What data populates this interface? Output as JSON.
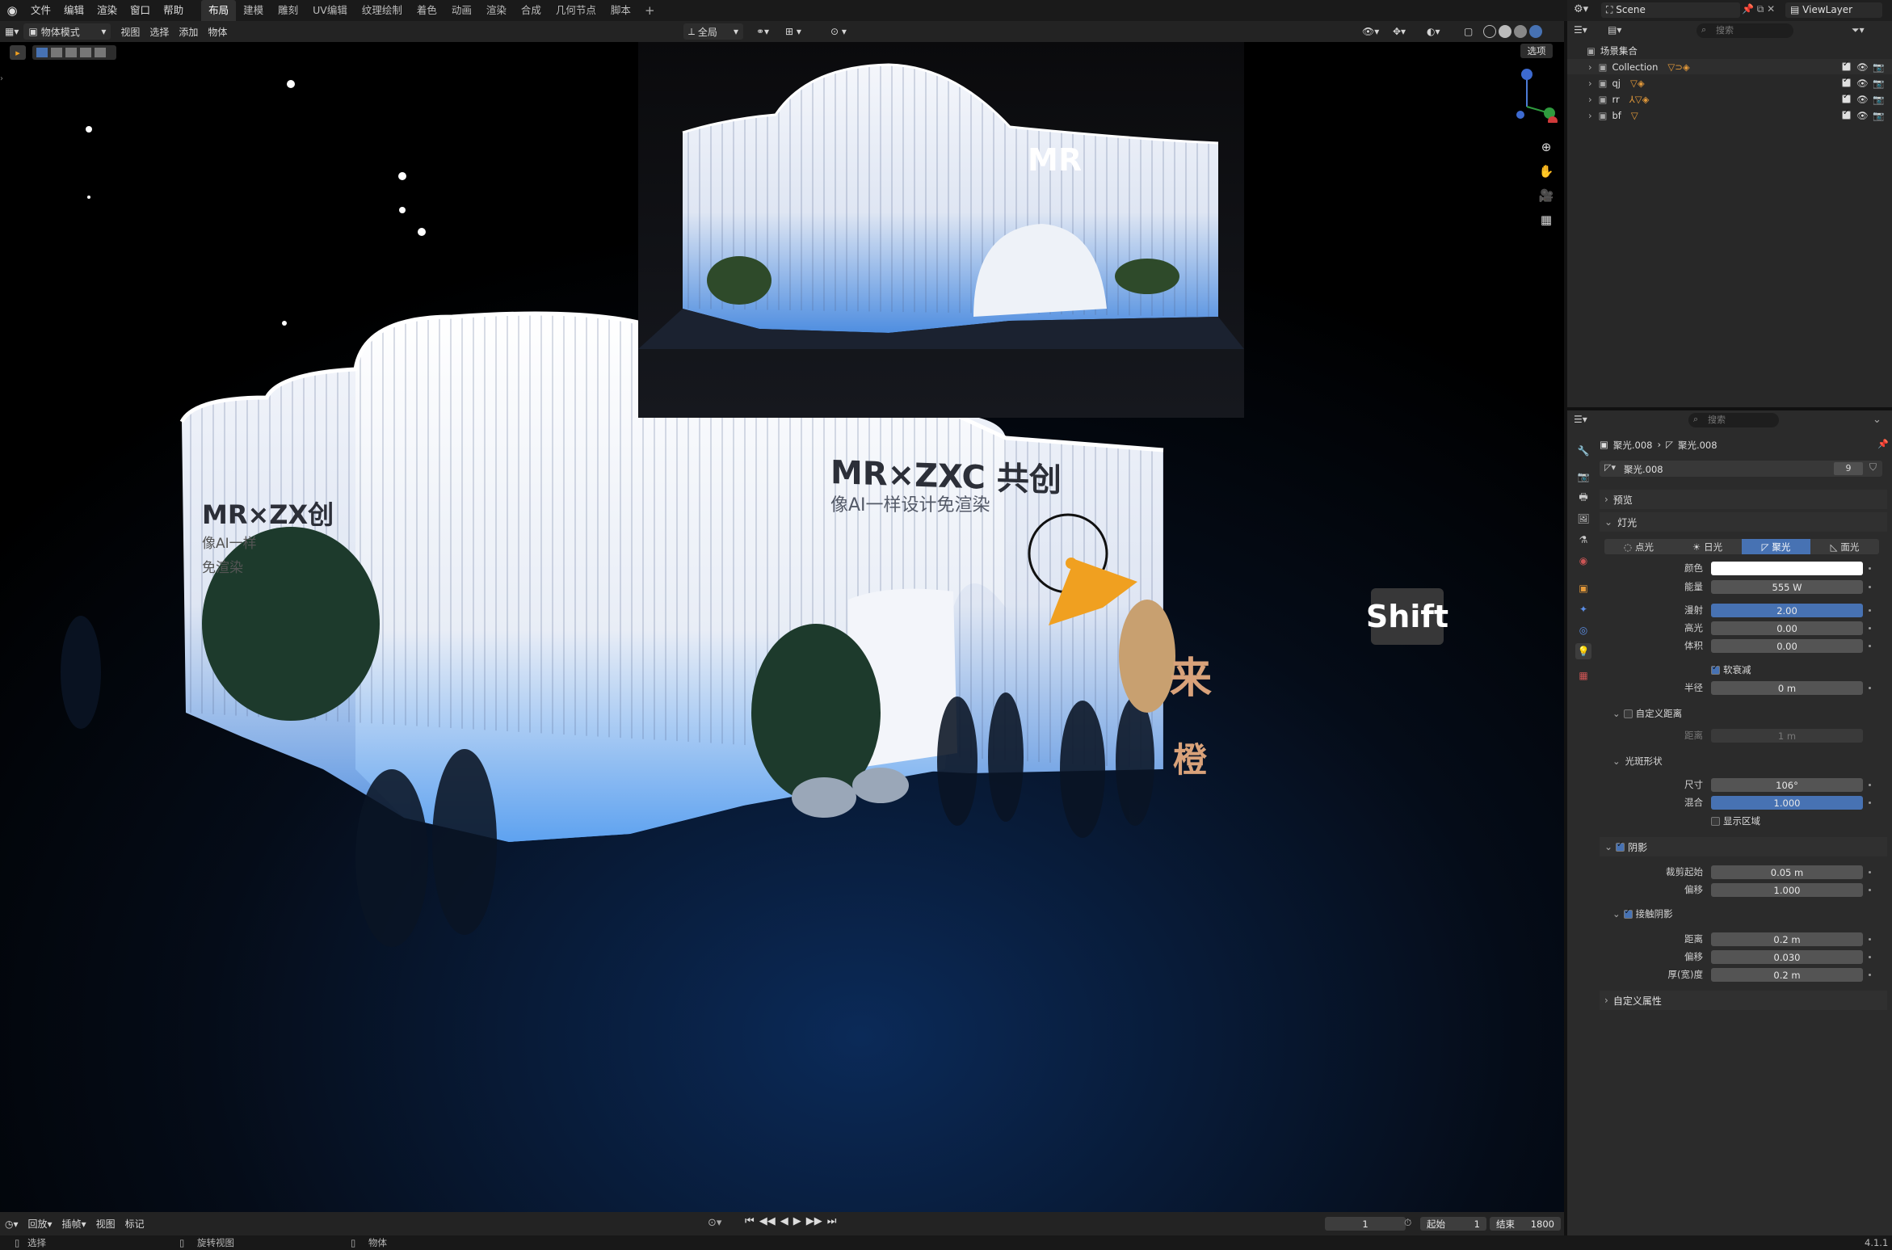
{
  "topbar": {
    "menus": [
      "文件",
      "编辑",
      "渲染",
      "窗口",
      "帮助"
    ],
    "workspaces": [
      "布局",
      "建模",
      "雕刻",
      "UV编辑",
      "纹理绘制",
      "着色",
      "动画",
      "渲染",
      "合成",
      "几何节点",
      "脚本"
    ],
    "scene": "Scene",
    "viewlayer": "ViewLayer"
  },
  "viewport_header": {
    "mode": "物体模式",
    "menus": [
      "视图",
      "选择",
      "添加",
      "物体"
    ],
    "orientation": "全局",
    "options": "选项"
  },
  "overlay": {
    "key": "Shift"
  },
  "render": {
    "main_sign_title": "MR×ZXC 共创",
    "main_sign_sub": "像AI一样设计免渲染",
    "left_sign_title": "MR×ZX创",
    "left_sign_sub1": "像AI一样",
    "left_sign_sub2": "免渲染",
    "inset_logo": "MR",
    "orange_chars": [
      "来",
      "橙"
    ]
  },
  "timeline": {
    "menus": [
      "回放",
      "插帧",
      "视图",
      "标记"
    ],
    "current_frame": "1",
    "start_label": "起始",
    "start": "1",
    "end_label": "结束",
    "end": "1800"
  },
  "statusbar": {
    "items": [
      "选择",
      "旋转视图",
      "物体"
    ],
    "version": "4.1.1"
  },
  "outliner": {
    "search_placeholder": "搜索",
    "root": "场景集合",
    "items": [
      {
        "name": "Collection",
        "count": ""
      },
      {
        "name": "qj",
        "count": ""
      },
      {
        "name": "rr",
        "count": ""
      },
      {
        "name": "bf",
        "count": ""
      }
    ]
  },
  "properties": {
    "search_placeholder": "搜索",
    "breadcrumb_obj": "聚光.008",
    "breadcrumb_data": "聚光.008",
    "datablock": "聚光.008",
    "users": "9",
    "panel_preview": "预览",
    "panel_light": "灯光",
    "light_types": [
      "点光",
      "日光",
      "聚光",
      "面光"
    ],
    "active_type": "聚光",
    "color_label": "颜色",
    "energy_label": "能量",
    "energy": "555 W",
    "diffuse_label": "漫射",
    "diffuse": "2.00",
    "specular_label": "高光",
    "specular": "0.00",
    "volume_label": "体积",
    "volume": "0.00",
    "soft_falloff": "软衰减",
    "radius_label": "半径",
    "radius": "0 m",
    "custom_distance": "自定义距离",
    "distance_label": "距离",
    "distance": "1 m",
    "spot_shape": "光斑形状",
    "size_label": "尺寸",
    "size": "106°",
    "blend_label": "混合",
    "blend": "1.000",
    "show_cone": "显示区域",
    "shadow": "阴影",
    "clip_start_label": "裁剪起始",
    "clip_start": "0.05 m",
    "bias_label": "偏移",
    "bias": "1.000",
    "contact_shadow": "接触阴影",
    "cs_distance_label": "距离",
    "cs_distance": "0.2 m",
    "cs_bias_label": "偏移",
    "cs_bias": "0.030",
    "cs_thickness_label": "厚(宽)度",
    "cs_thickness": "0.2 m",
    "custom_props": "自定义属性"
  },
  "colors": {
    "accent": "#4772b3",
    "orange": "#f0a020"
  }
}
